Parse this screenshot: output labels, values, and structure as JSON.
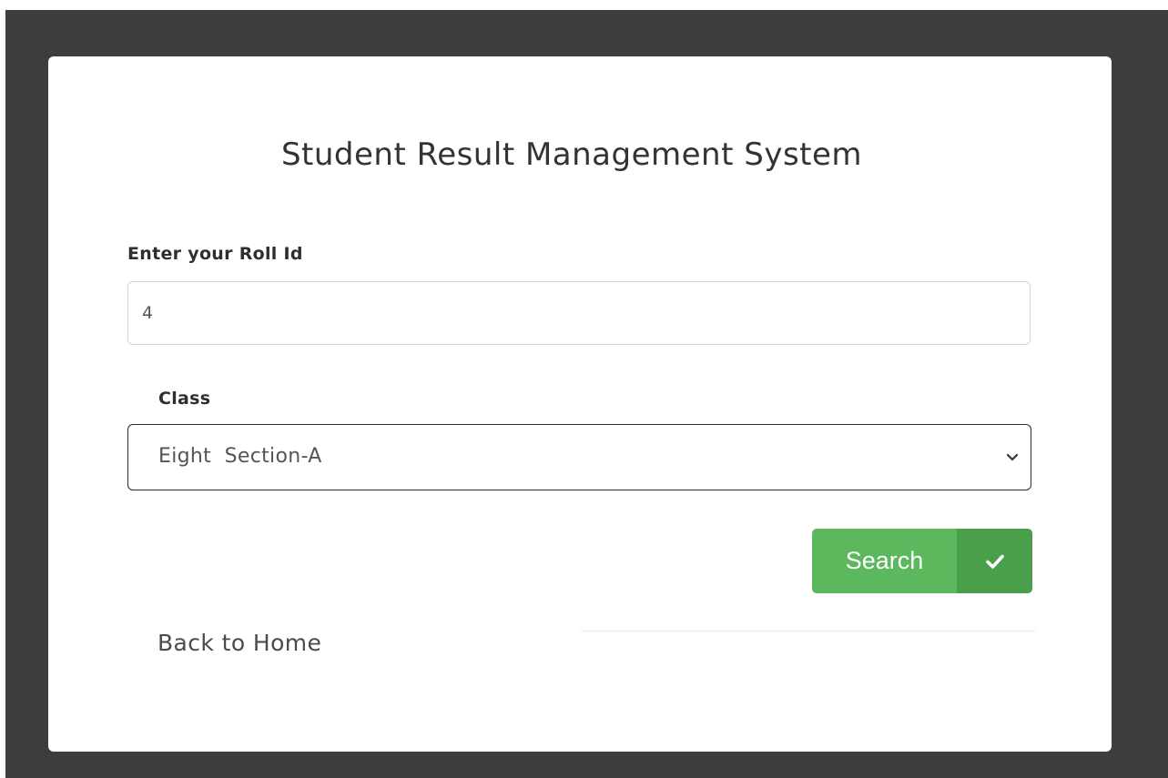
{
  "page": {
    "title": "Student Result Management System"
  },
  "form": {
    "roll_label": "Enter your Roll Id",
    "roll_value": "4",
    "class_label": "Class",
    "class_selected": "Eight  Section-A",
    "search_label": "Search",
    "search_icon": "check-icon"
  },
  "footer": {
    "back_link": "Back to Home"
  },
  "colors": {
    "backdrop": "#3d3d3d",
    "card": "#ffffff",
    "button": "#5cb85c",
    "button_icon_bg": "#4a9f4a"
  }
}
